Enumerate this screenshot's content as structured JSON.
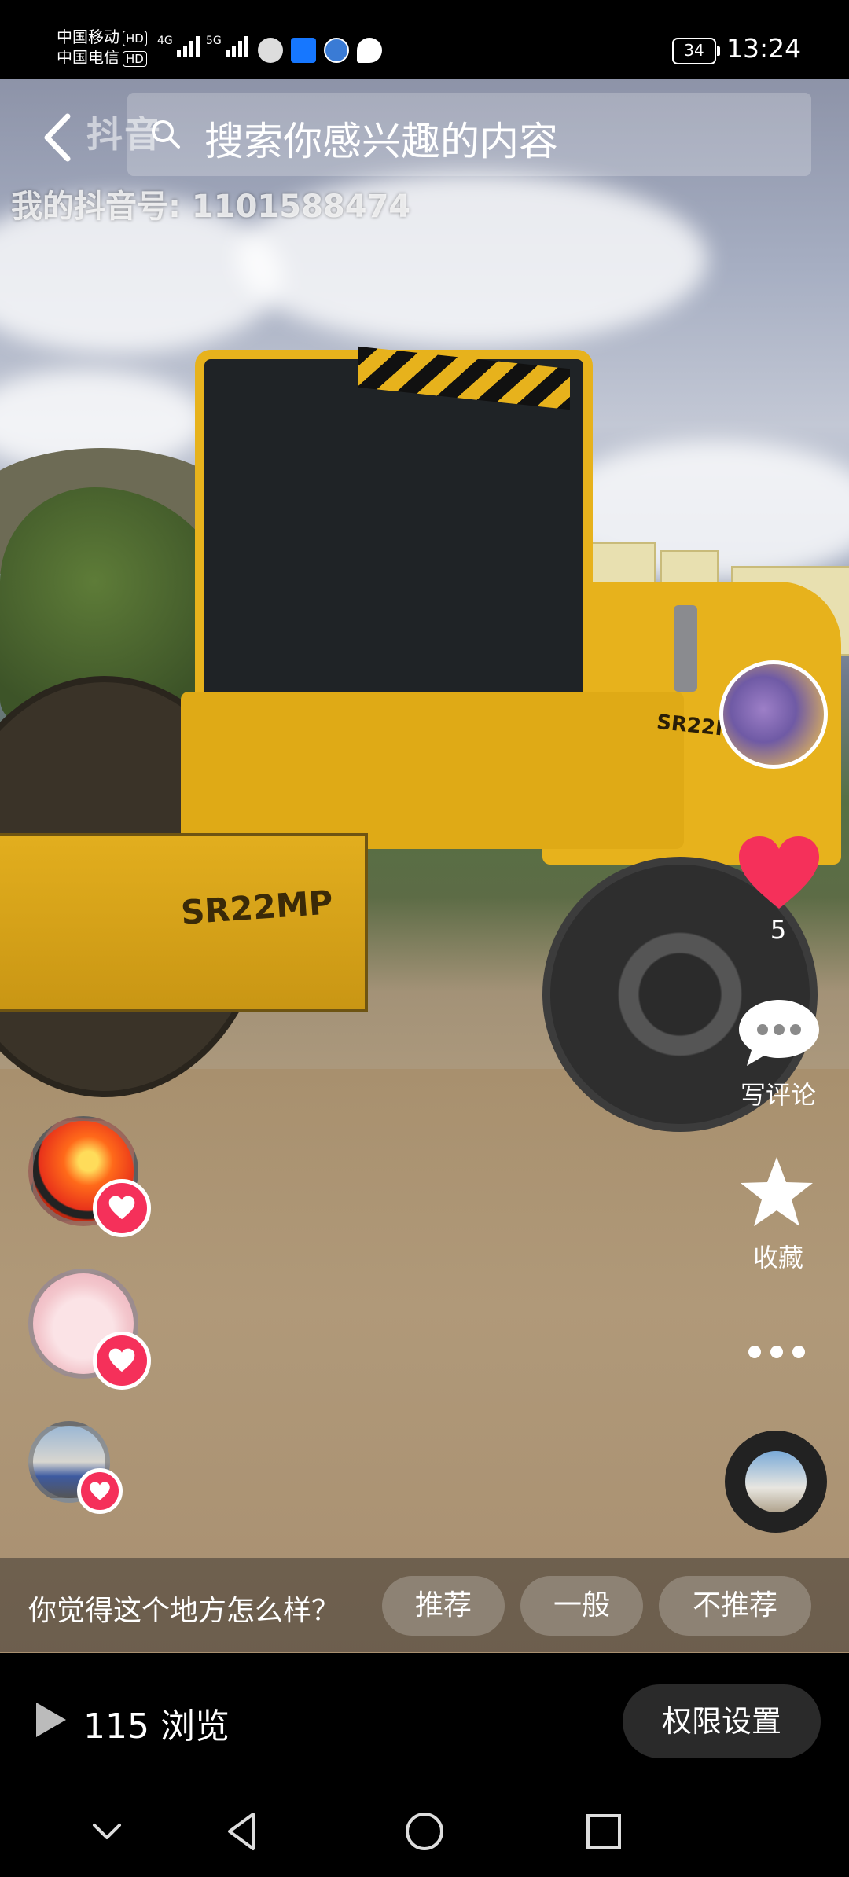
{
  "status_bar": {
    "carrier1": "中国移动",
    "carrier2": "中国电信",
    "hd": "HD",
    "net1": "4G",
    "net2": "5G",
    "battery": "34",
    "time": "13:24"
  },
  "watermark": {
    "brand": "抖音",
    "account_line": "我的抖音号: 1101588474"
  },
  "search": {
    "placeholder": "搜索你感兴趣的内容"
  },
  "side_actions": {
    "like_count": "5",
    "comment_label": "写评论",
    "favorite_label": "收藏"
  },
  "survey": {
    "question": "你觉得这个地方怎么样？",
    "options": [
      "推荐",
      "一般",
      "不推荐"
    ]
  },
  "footer": {
    "views": "115 浏览",
    "permissions_button": "权限设置"
  },
  "icons": {
    "back": "back-arrow-icon",
    "search": "search-icon",
    "like": "heart-icon",
    "comment": "comment-icon",
    "favorite": "star-icon",
    "more": "more-dots-icon",
    "play": "play-icon",
    "nav_down": "chevron-down-icon",
    "nav_back": "nav-back-icon",
    "nav_home": "nav-home-icon",
    "nav_recent": "nav-recent-icon"
  },
  "colors": {
    "like": "#f5305a",
    "machine_yellow": "#e7b21c",
    "button_bg": "#2a2a2a"
  }
}
